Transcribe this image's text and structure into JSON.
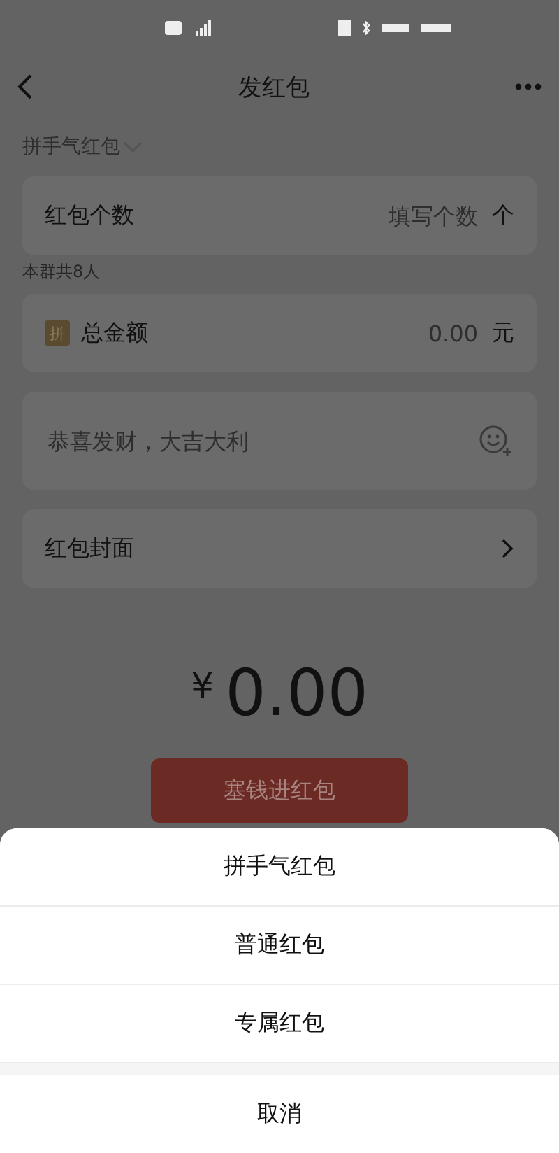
{
  "nav": {
    "title": "发红包"
  },
  "mode_selector": {
    "label": "拼手气红包"
  },
  "count_field": {
    "label": "红包个数",
    "placeholder": "填写个数",
    "unit": "个"
  },
  "group_note": "本群共8人",
  "amount_field": {
    "badge": "拼",
    "label": "总金额",
    "placeholder": "0.00",
    "unit": "元"
  },
  "greeting_field": {
    "placeholder": "恭喜发财，大吉大利"
  },
  "cover_row": {
    "label": "红包封面"
  },
  "total": {
    "currency": "¥",
    "amount": "0.00"
  },
  "submit_button": {
    "label": "塞钱进红包",
    "disabled": true
  },
  "action_sheet": {
    "options": [
      "拼手气红包",
      "普通红包",
      "专属红包"
    ],
    "cancel": "取消"
  }
}
